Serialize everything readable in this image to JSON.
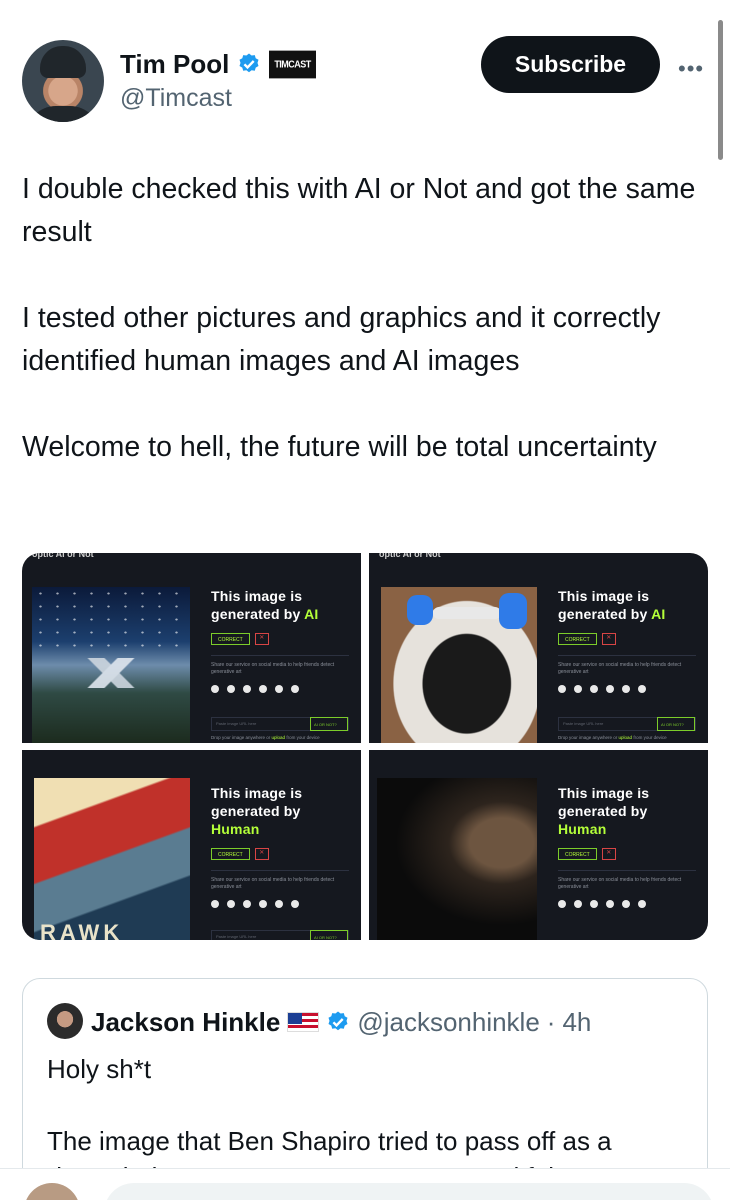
{
  "author": {
    "name": "Tim Pool",
    "handle": "@Timcast",
    "badge_label": "TIMCAST"
  },
  "header": {
    "subscribe_label": "Subscribe",
    "more_label": "•••"
  },
  "tweet": {
    "paragraphs": [
      "I double checked this with AI or Not and got the same result",
      "I tested other pictures and graphics and it correctly identified human images and AI images",
      "Welcome to hell, the future will be total uncertainty"
    ]
  },
  "media": {
    "brand": "optic AI or Not",
    "cells": [
      {
        "title_prefix": "This image is generated by",
        "verdict": "AI",
        "correct_label": "CORRECT",
        "share_text": "Share our service on social media to help friends detect generative art",
        "url_placeholder": "Paste image URL here",
        "go_label": "AI OR NOT?",
        "drop_prefix": "Drop your image anywhere or",
        "drop_link": "upload",
        "drop_suffix": "from your device"
      },
      {
        "title_prefix": "This image is generated by",
        "verdict": "AI",
        "correct_label": "CORRECT",
        "share_text": "Share our service on social media to help friends detect generative art",
        "url_placeholder": "Paste image URL here",
        "go_label": "AI OR NOT?",
        "drop_prefix": "Drop your image anywhere or",
        "drop_link": "upload",
        "drop_suffix": "from your device"
      },
      {
        "title_prefix": "This image is generated by",
        "verdict": "Human",
        "correct_label": "CORRECT",
        "share_text": "Share our service on social media to help friends detect generative art",
        "url_placeholder": "Paste image URL here",
        "go_label": "AI OR NOT?"
      },
      {
        "title_prefix": "This image is generated by",
        "verdict": "Human",
        "correct_label": "CORRECT",
        "share_text": "Share our service on social media to help friends detect generative art"
      }
    ],
    "poster_text": "RAWK"
  },
  "quote": {
    "name": "Jackson Hinkle",
    "handle": "@jacksonhinkle",
    "separator": "·",
    "time": "4h",
    "paragraphs": [
      "Holy sh*t",
      "The image that Ben Shapiro tried to pass off as a \"burnt baby corpse\" was an AI-generated fake"
    ]
  },
  "colors": {
    "accent_ai": "#b4ff39",
    "verified_blue": "#1d9bf0",
    "subscribe_bg": "#0f1419",
    "card_bg": "#15181f"
  }
}
